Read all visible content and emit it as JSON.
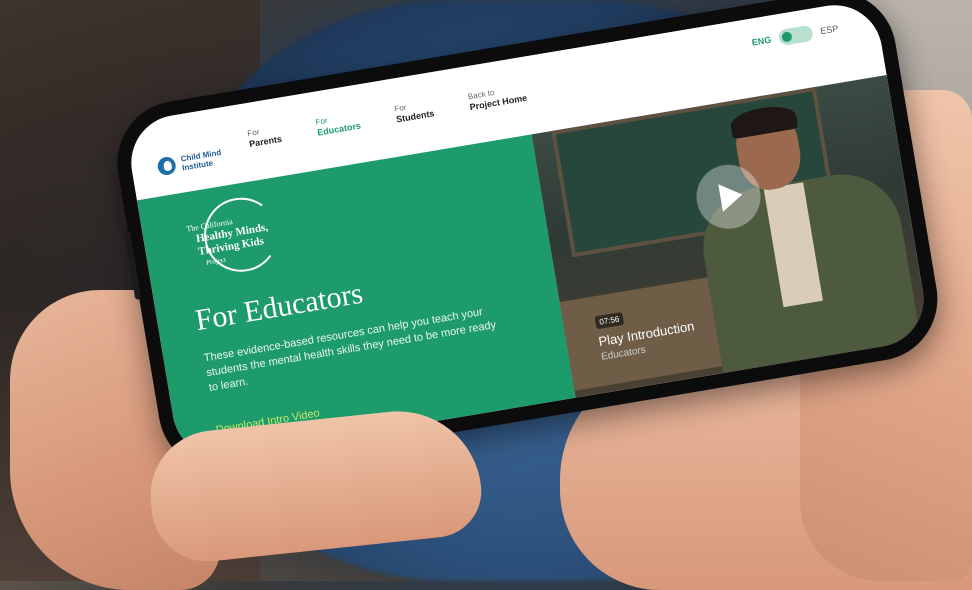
{
  "header": {
    "logo_text": "Child Mind Institute",
    "nav": [
      {
        "small": "For",
        "big": "Parents"
      },
      {
        "small": "For",
        "big": "Educators"
      },
      {
        "small": "For",
        "big": "Students"
      },
      {
        "small": "Back to",
        "big": "Project Home"
      }
    ],
    "lang_eng": "ENG",
    "lang_esp": "ESP"
  },
  "project_logo": {
    "line1": "The California",
    "line2": "Healthy Minds,",
    "line3": "Thriving Kids",
    "line4": "Project"
  },
  "hero": {
    "title": "For Educators",
    "description": "These evidence-based resources can help you teach your students the mental health skills they need to be more ready to learn.",
    "download": "Download Intro Video"
  },
  "video": {
    "duration": "07:56",
    "label": "Play Introduction",
    "sublabel": "Educators"
  },
  "colors": {
    "brand_green": "#1e9b6a",
    "link_yellow": "#c6e86b"
  }
}
